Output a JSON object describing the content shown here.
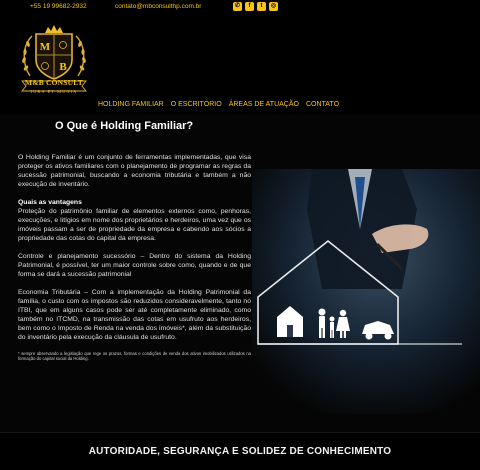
{
  "topbar": {
    "phone": "+55 19 99682-2932",
    "email": "contato@mbconsulthp.com.br",
    "social_icons": [
      "whatsapp-icon",
      "facebook-icon",
      "twitter-icon",
      "instagram-icon"
    ],
    "accent_color": "#f5c518"
  },
  "logo": {
    "name": "M&B CONSULT",
    "tagline": "IURA ET MUNIA",
    "monogram_top": "M",
    "monogram_bottom": "B"
  },
  "nav": {
    "items": [
      "HOLDING FAMILIAR",
      "O ESCRITÓRIO",
      "ÁREAS DE ATUAÇÃO",
      "CONTATO"
    ]
  },
  "main": {
    "title": "O Que é Holding Familiar?",
    "p1": "O Holding Familiar é um conjunto de ferramentas implementadas, que visa proteger os ativos familiares com o planejamento de programar as regras da sucessão patrimonial, buscando a economia tributária e também a não execução de inventário.",
    "sub": "Quais as vantagens",
    "p2": "Proteção do patrimônio familiar de elementos externos como, penhoras, execuções, e litígios em nome dos proprietários e herdeiros, uma vez que os imóveis passam a ser de propriedade da empresa e cabendo aos sócios a propriedade das cotas do capital da empresa.",
    "p3": "Controle e planejamento sucessório – Dentro do sistema da Holding Patrimonial, é possível, ter um maior controle sobre como, quando e de que forma se dará a sucessão patrimonial",
    "p4": "Economia Tributária – Com a implementação da Holding Patrimonial da família, o custo com os impostos são reduzidos consideravelmente, tanto no ITBI, que em alguns casos pode ser até completamente eliminado, como também no ITCMD, na transmissão das cotas em usufruto aos herdeiros, bem como o Imposto de Renda na venda dos imóveis*, além da substituição do inventário pela execução da cláusula de usufruto.",
    "note": "* sempre observando a legislação que rege os prazos, formas e condições de venda dos ativos imobilizados utilizados na formação do capital social da Holding."
  },
  "footer": {
    "slogan": "AUTORIDADE, SEGURANÇA E SOLIDEZ DE CONHECIMENTO"
  }
}
